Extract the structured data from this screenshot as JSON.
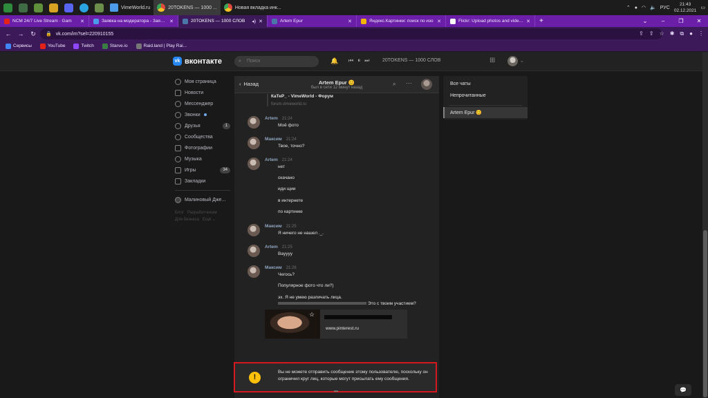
{
  "taskbar": {
    "apps": [
      {
        "label": "",
        "color": "#2e8b3e"
      },
      {
        "label": "",
        "color": "#3f6b45"
      },
      {
        "label": "",
        "color": "#5f8f3a"
      },
      {
        "label": "",
        "color": "#d8a322"
      },
      {
        "label": "",
        "color": "#5865f2"
      },
      {
        "label": "",
        "color": "#2aa3e0"
      },
      {
        "label": "",
        "color": "#6b8f4a"
      }
    ],
    "windows": [
      {
        "label": "VimeWorld.ru",
        "color": "#4b9be8",
        "active": false
      },
      {
        "label": "20TOKENS — 1000 ...",
        "color": "#e04a3c",
        "active": true
      },
      {
        "label": "Новая вкладка инк...",
        "color": "#e04a3c",
        "active": false
      }
    ],
    "lang": "РУС",
    "time": "21:43",
    "date": "02.12.2021"
  },
  "tabs": [
    {
      "title": "NCM 24/7 Live Stream · Gam",
      "color": "#e62117",
      "active": false
    },
    {
      "title": "Заявка на модератора - Заявки",
      "color": "#4b9be8",
      "active": false
    },
    {
      "title": "20TOKENS — 1000 СЛОВ",
      "color": "#4a76a8",
      "active": true
    },
    {
      "title": "Artem Epur",
      "color": "#4a76a8",
      "active": false
    },
    {
      "title": "Яндекс.Картинки: поиск по изо",
      "color": "#f2b600",
      "active": false
    },
    {
      "title": "Flickr: Upload photos and videos",
      "color": "#ffffff",
      "active": false
    }
  ],
  "address": {
    "url": "vk.com/im?sel=220910155"
  },
  "bookmarks": [
    {
      "label": "Сервисы",
      "color": "#4285f4"
    },
    {
      "label": "YouTube",
      "color": "#e62117"
    },
    {
      "label": "Twitch",
      "color": "#9146ff"
    },
    {
      "label": "Starve.io",
      "color": "#3a7d44"
    },
    {
      "label": "Raid.land | Play Rai...",
      "color": "#777777"
    }
  ],
  "vk": {
    "logo": "вконтакте",
    "search_placeholder": "Поиск",
    "track": "20TOKENS — 1000 СЛОВ",
    "nav": [
      {
        "label": "Моя страница",
        "icon": "profile-icon"
      },
      {
        "label": "Новости",
        "icon": "news-icon"
      },
      {
        "label": "Мессенджер",
        "icon": "messenger-icon"
      },
      {
        "label": "Звонки",
        "icon": "calls-icon",
        "dot": true
      },
      {
        "label": "Друзья",
        "icon": "friends-icon",
        "count": "1"
      },
      {
        "label": "Сообщества",
        "icon": "communities-icon"
      },
      {
        "label": "Фотографии",
        "icon": "photos-icon"
      },
      {
        "label": "Музыка",
        "icon": "music-icon"
      },
      {
        "label": "Игры",
        "icon": "games-icon",
        "count": "34"
      },
      {
        "label": "Закладки",
        "icon": "bookmarks-icon"
      }
    ],
    "nav_extra": "Малиновый Дже...",
    "footer_links": [
      "Блог",
      "Разработчикам",
      "Для бизнеса",
      "Ещё ⌄"
    ]
  },
  "chat": {
    "back": "Назад",
    "name": "Artem Epur",
    "status": "был в сети 12 минут назад",
    "link_preview": {
      "title": "КаТеР_ - VimeWorld - Форум",
      "url": "forum.vimeworld.ru"
    },
    "messages": [
      {
        "author": "Artem",
        "time": "21:24",
        "lines": [
          "Моё фото"
        ]
      },
      {
        "author": "Максим",
        "time": "21:24",
        "lines": [
          "Твое, точно?"
        ]
      },
      {
        "author": "Artem",
        "time": "21:24",
        "lines": [
          "нет",
          "скачано",
          "иди щии",
          "в интернете",
          "по картинке"
        ]
      },
      {
        "author": "Максим",
        "time": "21:25",
        "lines": [
          "Я ничего не нашел ._."
        ]
      },
      {
        "author": "Artem",
        "time": "21:25",
        "lines": [
          "Ваyyyy"
        ]
      },
      {
        "author": "Максим",
        "time": "21:26",
        "lines": [
          "Чегось?",
          "Популярное фото что ли?)",
          "эх. Я не умею различать лица.",
          "Это с твоим участием?"
        ]
      }
    ],
    "attachment_site": "www.pinterest.ru",
    "warning": "Вы не можете отправить сообщение этому пользователю, поскольку он ограничил круг лиц, которые могут присылать ему сообщения."
  },
  "right_panel": {
    "all_chats": "Все чаты",
    "unread": "Непрочитанные",
    "active_chat": "Artem Epur"
  },
  "colors": {
    "browser_accent": "#6b1fa8",
    "vk_blue": "#2787f5",
    "warning_border": "#d7191f",
    "warning_icon": "#ffc107"
  }
}
